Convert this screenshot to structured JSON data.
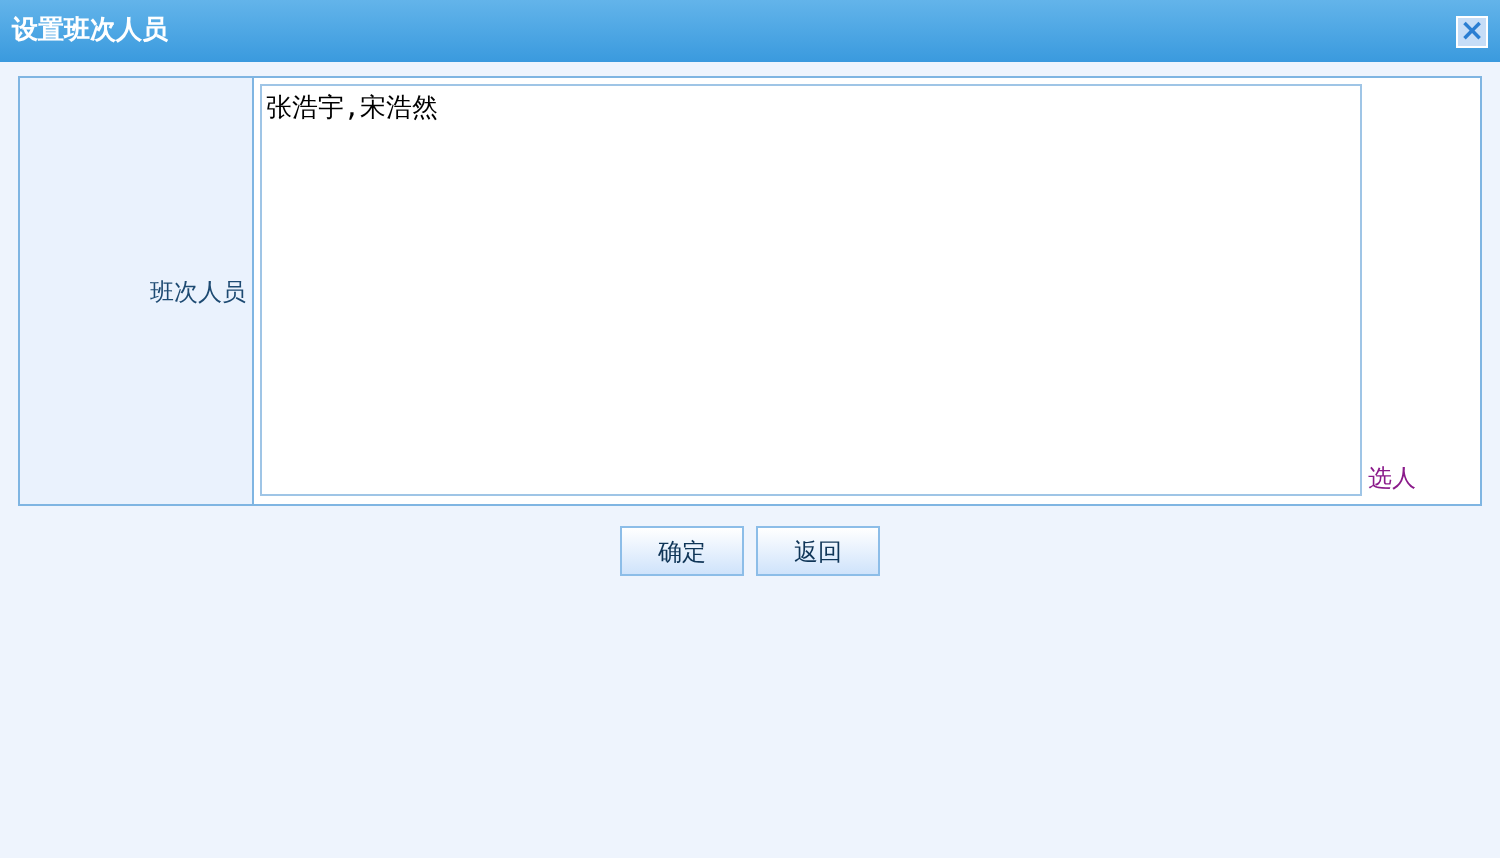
{
  "window": {
    "title": "设置班次人员",
    "close": "×"
  },
  "form": {
    "label": "班次人员",
    "value": "张浩宇,宋浩然",
    "link": "选人"
  },
  "buttons": [
    "确定",
    "返回"
  ]
}
